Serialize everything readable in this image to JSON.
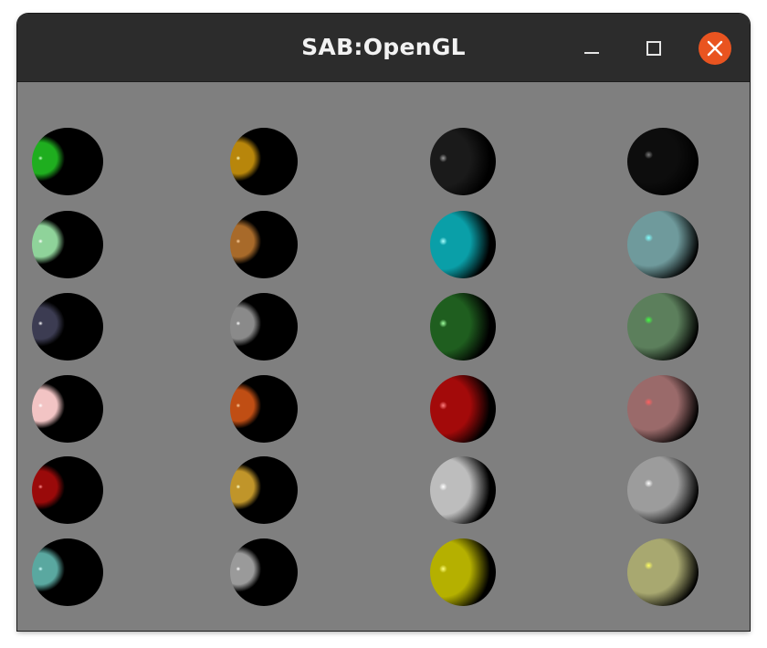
{
  "window": {
    "title": "SAB:OpenGL"
  },
  "titlebar_icons": {
    "minimize": "minimize-icon",
    "maximize": "maximize-icon",
    "close": "close-icon"
  },
  "colors": {
    "titlebar_bg": "#2c2c2c",
    "canvas_bg": "#7f7f7f",
    "close_button": "#e95420"
  },
  "spheres": {
    "columns": 4,
    "rows": 6,
    "materials": [
      [
        "#1fae1f",
        "#b8860b",
        "#1a1a1a",
        "#0d0d0d"
      ],
      [
        "#8fd39a",
        "#a86a2a",
        "#0a9fa8",
        "#6f9a9c"
      ],
      [
        "#3c3c52",
        "#8a8a8a",
        "#1f5e1f",
        "#5c7f5c"
      ],
      [
        "#f2c4c4",
        "#c04e14",
        "#a30a0a",
        "#9a6a6a"
      ],
      [
        "#9a0a0a",
        "#c0952a",
        "#bdbdbd",
        "#9c9c9c"
      ],
      [
        "#5aa8a0",
        "#9a9a9a",
        "#b5b000",
        "#a8a870"
      ]
    ],
    "highlights": [
      [
        "#c8ffc8",
        "#ffffc0",
        "#9a9a9a",
        "#7a7a7a"
      ],
      [
        "#ffffff",
        "#ffd2a0",
        "#aaffff",
        "#80ffff"
      ],
      [
        "#ffffff",
        "#ffffff",
        "#a0ffa0",
        "#40ff40"
      ],
      [
        "#ffffff",
        "#ffd0a0",
        "#ff8080",
        "#ff6060"
      ],
      [
        "#ff9090",
        "#ffffc8",
        "#ffffff",
        "#ffffff"
      ],
      [
        "#d0ffff",
        "#ffffff",
        "#ffff80",
        "#ffff60"
      ]
    ]
  }
}
